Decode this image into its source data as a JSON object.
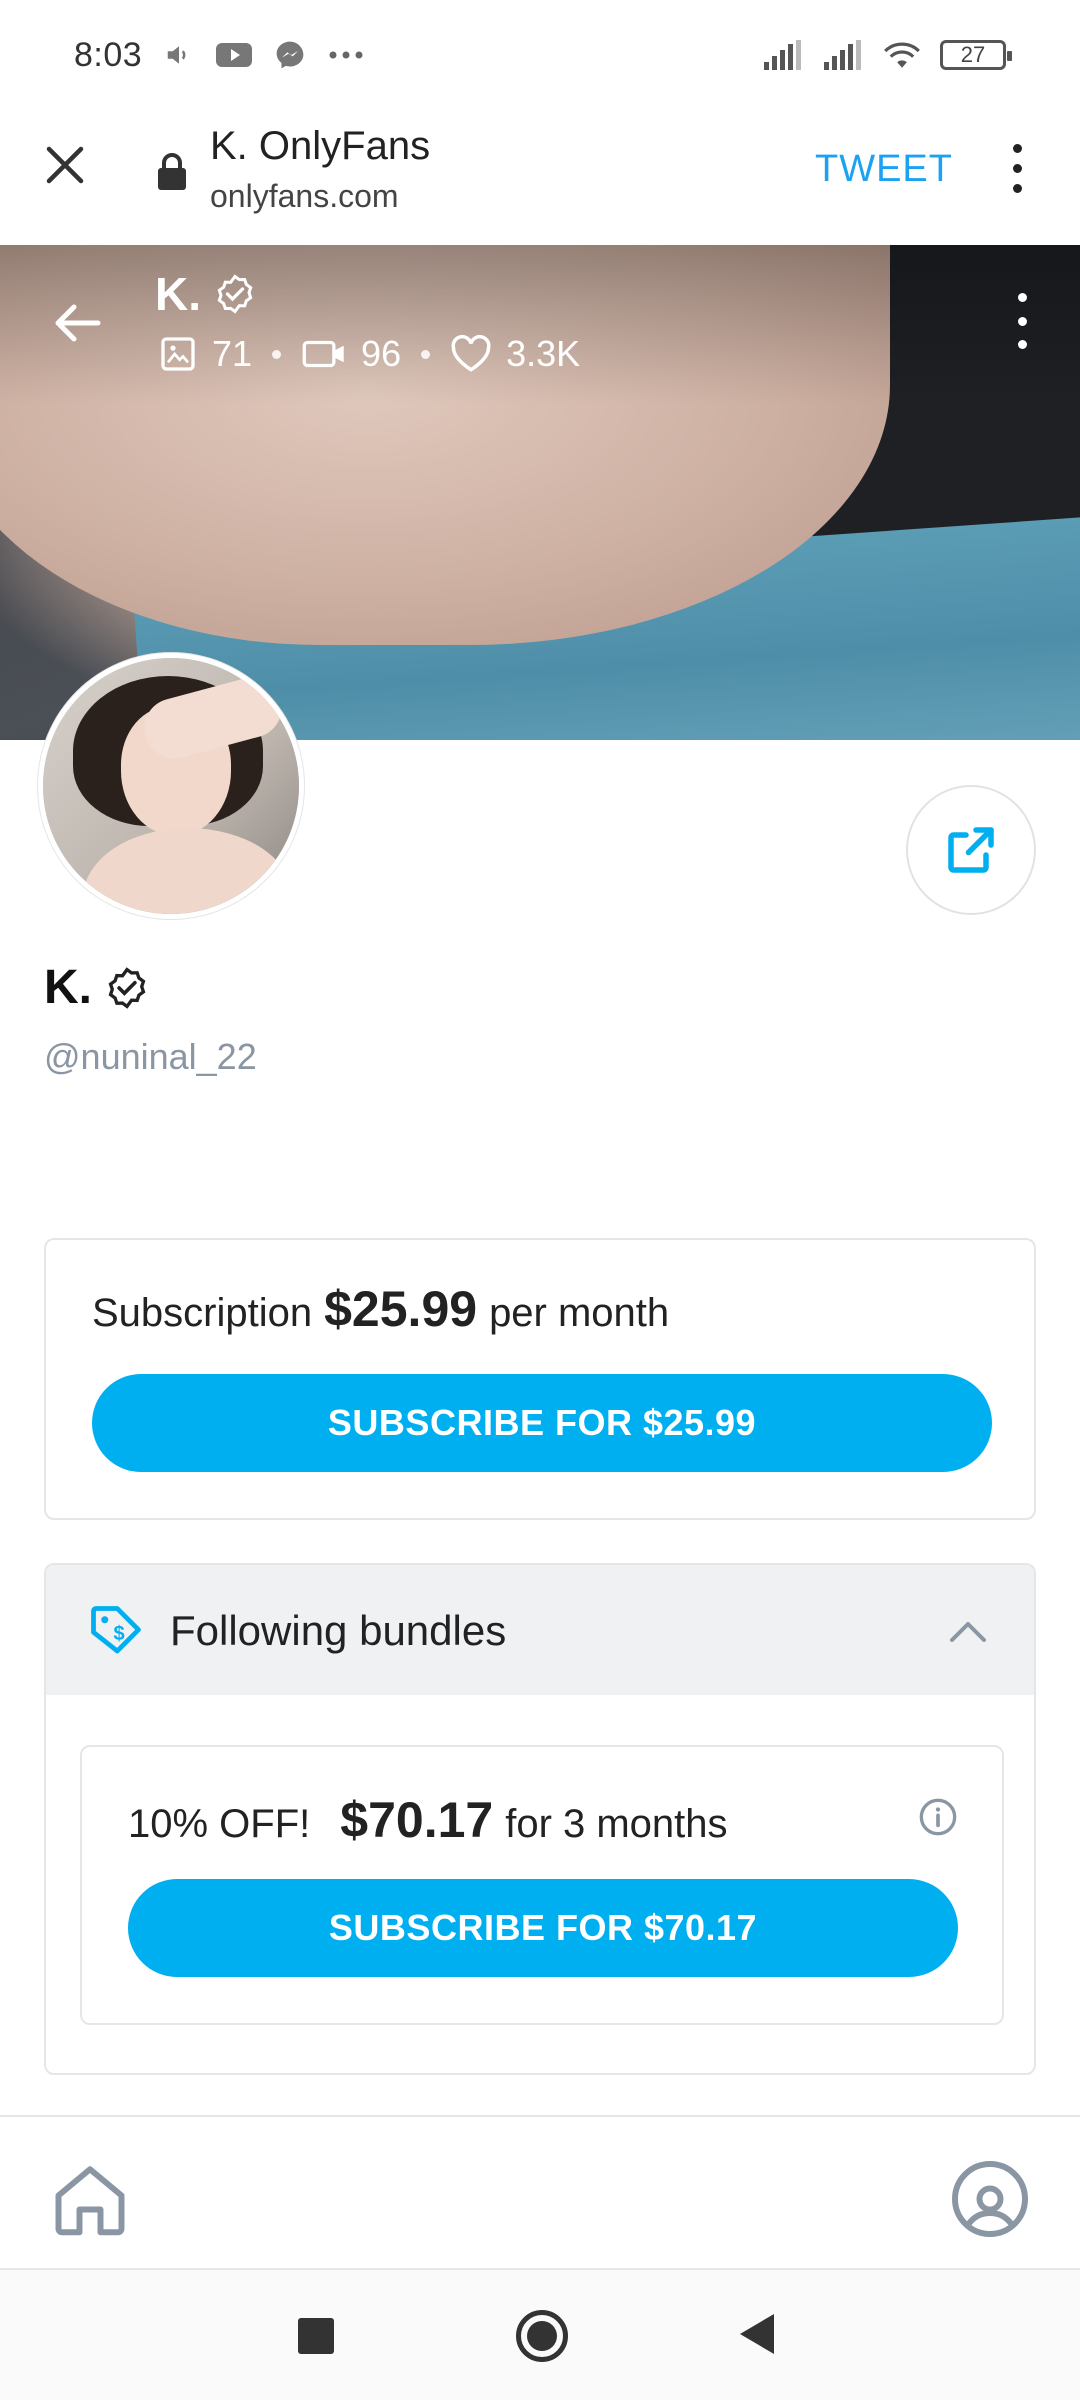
{
  "status_bar": {
    "time": "8:03",
    "battery": "27",
    "icons": [
      "speaker-icon",
      "youtube-icon",
      "messenger-icon",
      "more-dots-icon",
      "signal-icon",
      "signal-icon",
      "wifi-icon",
      "battery-icon"
    ]
  },
  "browser": {
    "title": "K. OnlyFans",
    "url": "onlyfans.com",
    "tweet_label": "TWEET"
  },
  "cover": {
    "name": "K.",
    "stats": {
      "photos": "71",
      "videos": "96",
      "likes": "3.3K"
    }
  },
  "profile": {
    "name": "K.",
    "handle": "@nuninal_22"
  },
  "subscription": {
    "label": "Subscription",
    "price": "$25.99",
    "period": "per month",
    "button_label": "SUBSCRIBE FOR $25.99"
  },
  "bundles": {
    "title": "Following bundles",
    "items": [
      {
        "discount": "10% OFF!",
        "price": "$70.17",
        "period": "for 3 months",
        "button_label": "SUBSCRIBE FOR $70.17"
      }
    ]
  },
  "colors": {
    "accent": "#00aff0",
    "tweet": "#1da1f2",
    "handle": "#8a96a3"
  }
}
